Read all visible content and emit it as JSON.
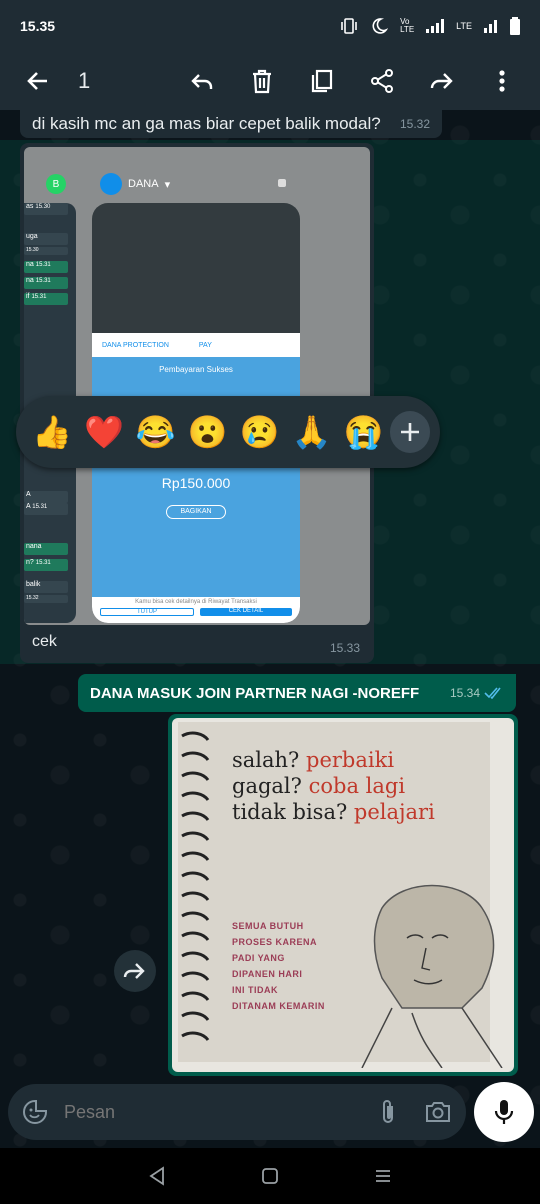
{
  "status_bar": {
    "time": "15.35",
    "network": "LTE"
  },
  "toolbar": {
    "selected_count": "1"
  },
  "messages": {
    "prev": {
      "text": "di kasih mc an ga mas biar cepet balik modal?",
      "time": "15.32"
    },
    "image_msg": {
      "caption": "cek",
      "time": "15.33"
    },
    "outgoing": {
      "text": "DANA MASUK JOIN PARTNER NAGI -NOREFF",
      "time": "15.34"
    }
  },
  "screenshot": {
    "app_name": "DANA",
    "whatsapp_badge": "B",
    "pay_label": "PAY",
    "dana_protection": "DANA PROTECTION",
    "payment_title": "Pembayaran Sukses",
    "amount": "Rp150.000",
    "share_label": "BAGIKAN",
    "footer_text": "Kamu bisa cek detailnya di Riwayat Transaksi",
    "close_label": "TUTUP",
    "detail_label": "CEK DETAIL",
    "left_list": [
      {
        "text": "as",
        "time": "15.30"
      },
      {
        "text": "uga",
        "time": "15.30"
      },
      {
        "text": "na",
        "time": "15.31"
      },
      {
        "text": "na",
        "time": "15.31"
      },
      {
        "text": "if",
        "time": "15.31"
      }
    ],
    "left_list_bottom": [
      {
        "text": "A",
        "time": ""
      },
      {
        "text": "A",
        "time": "15.31"
      },
      {
        "text": "nana",
        "time": ""
      },
      {
        "text": "n?",
        "time": "15.31"
      },
      {
        "text": "balik",
        "time": "15.32"
      }
    ]
  },
  "reactions": [
    "👍",
    "❤️",
    "😂",
    "😮",
    "😢",
    "🙏",
    "😭"
  ],
  "quote_image": {
    "line1_black": "salah?",
    "line1_red": "perbaiki",
    "line2_black": "gagal?",
    "line2_red": "coba lagi",
    "line3_black": "tidak bisa?",
    "line3_red": "pelajari",
    "small_lines": [
      "SEMUA BUTUH",
      "PROSES KARENA",
      "PADI YANG",
      "DIPANEN HARI",
      "INI TIDAK",
      "DITANAM KEMARIN"
    ]
  },
  "input": {
    "placeholder": "Pesan"
  },
  "colors": {
    "header_bg": "#1f2c34",
    "outgoing_bubble": "#005c4b",
    "incoming_bubble": "#1f2c34",
    "chat_bg": "#0b141a",
    "read_tick": "#53bdeb"
  }
}
